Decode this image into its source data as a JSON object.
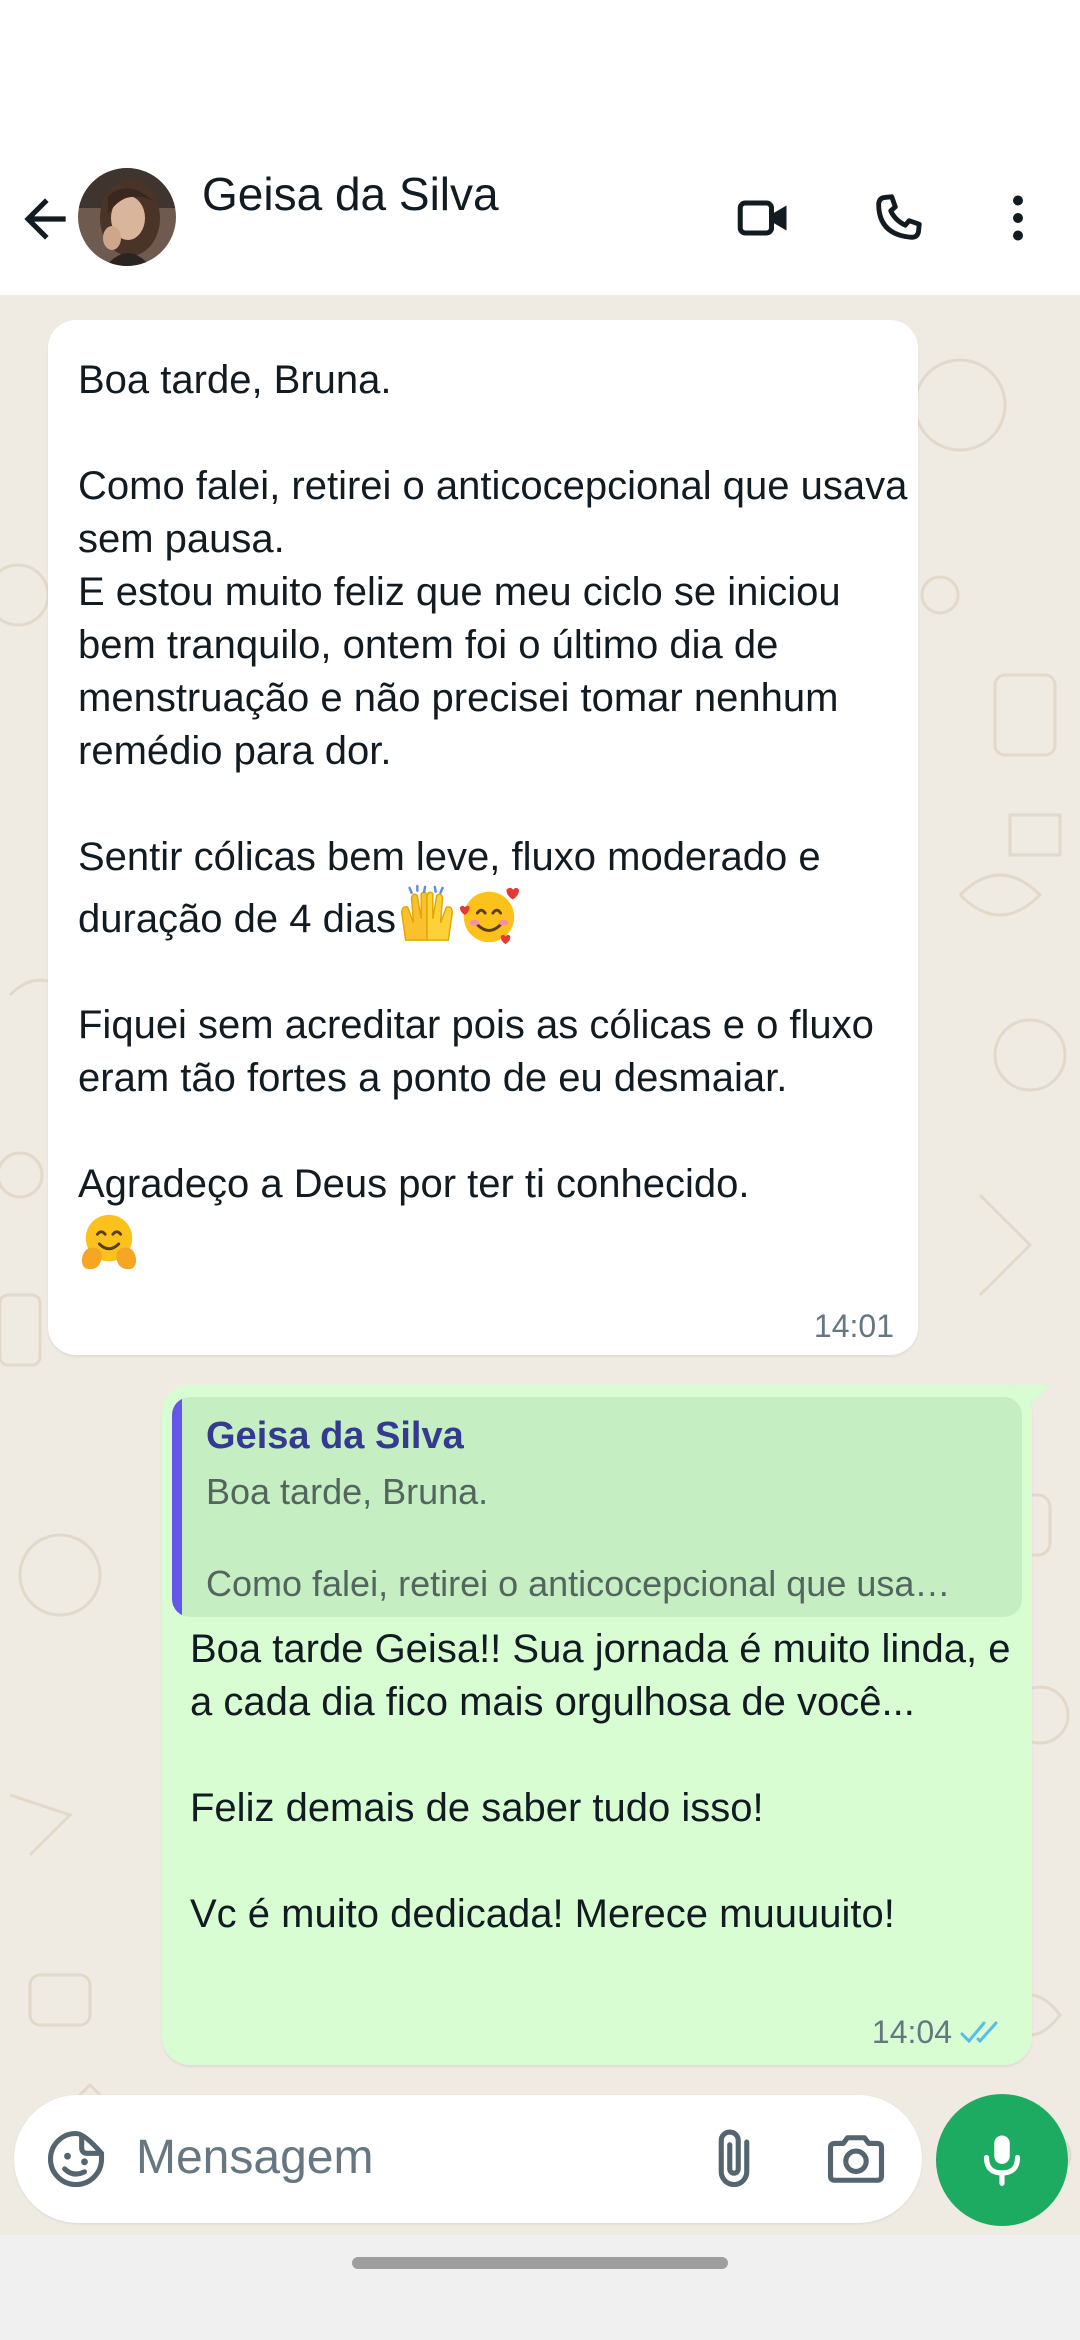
{
  "header": {
    "contact_name": "Geisa da Silva",
    "icons": [
      "back-arrow-icon",
      "video-call-icon",
      "voice-call-icon",
      "more-options-icon"
    ]
  },
  "messages": {
    "incoming": {
      "text_lines": [
        "Boa tarde, Bruna.",
        "",
        "Como falei, retirei o anticocepcional que usava sem pausa.",
        "E estou muito feliz que meu ciclo se iniciou bem tranquilo, ontem foi o último dia de menstruação e não precisei tomar nenhum remédio para dor.",
        "",
        "Sentir cólicas bem leve, fluxo moderado e duração de 4 dias",
        "",
        "Fiquei sem acreditar pois as cólicas e o fluxo eram tão fortes a ponto de eu desmaiar.",
        "",
        "Agradeço a Deus por ter ti conhecido."
      ],
      "emojis": [
        "raising-hands-emoji",
        "smiling-face-with-hearts-emoji",
        "hugging-face-emoji"
      ],
      "time": "14:01"
    },
    "outgoing": {
      "quote_name": "Geisa da Silva",
      "quote_line1": "Boa tarde, Bruna.",
      "quote_line2": "Como falei, retirei o anticocepcional que usa…",
      "text": "Boa tarde Geisa!! Sua jornada é muito linda, e a cada dia fico mais orgulhosa de você...\n\nFeliz demais de saber tudo isso!\n\nVc é muito dedicada! Merece muuuuito!",
      "time": "14:04",
      "status": "read"
    }
  },
  "composer": {
    "placeholder": "Mensagem"
  },
  "colors": {
    "chat_background": "#efeae2",
    "incoming_bubble": "#ffffff",
    "outgoing_bubble": "#d9fdd3",
    "mic_button": "#1daa61",
    "read_ticks": "#53bdeb",
    "quote_bar": "#6257e8"
  }
}
